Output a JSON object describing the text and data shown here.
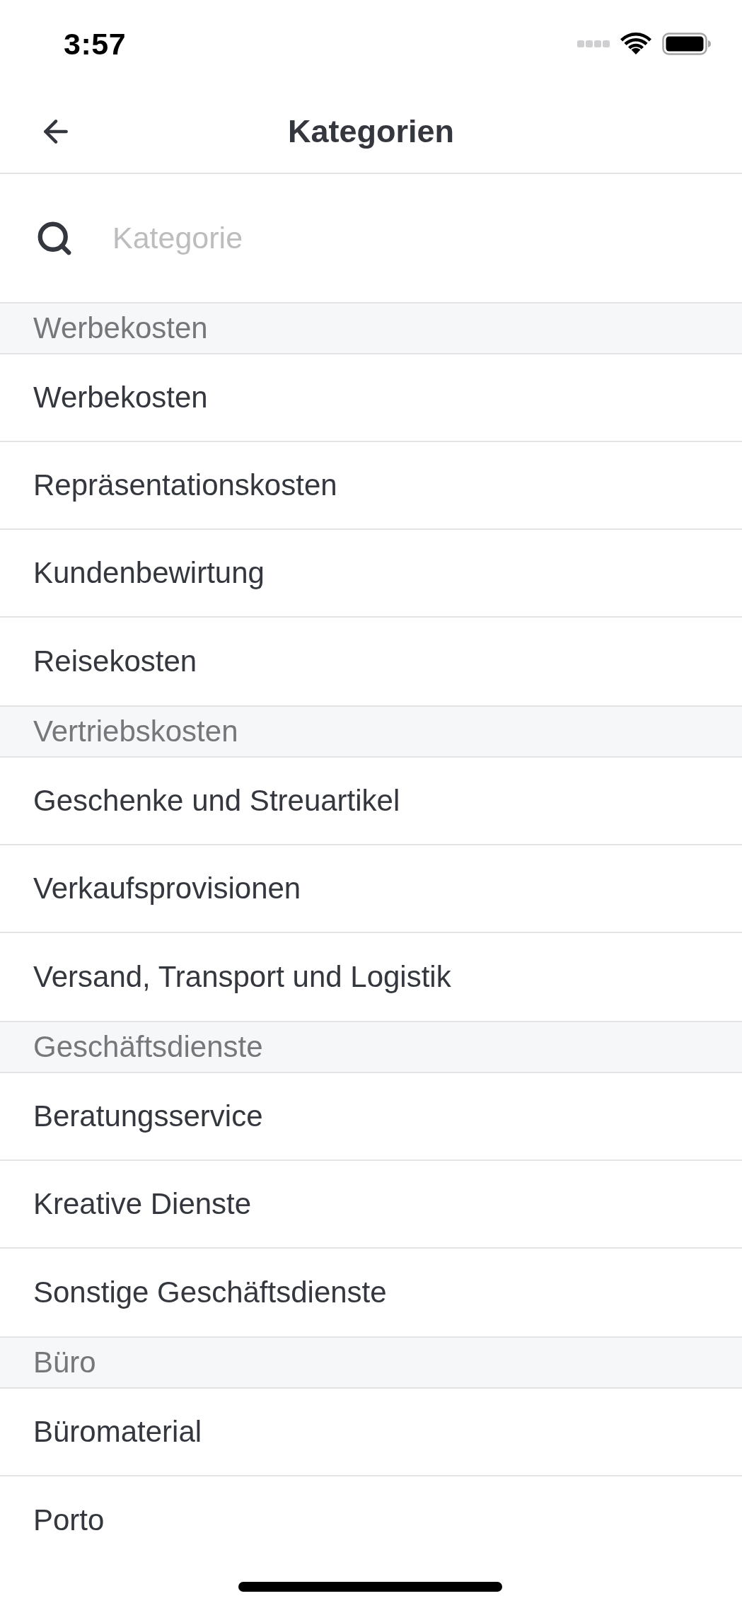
{
  "status_bar": {
    "time": "3:57"
  },
  "header": {
    "title": "Kategorien"
  },
  "search": {
    "placeholder": "Kategorie"
  },
  "sections": [
    {
      "title": "Werbekosten",
      "items": [
        "Werbekosten",
        "Repräsentationskosten",
        "Kundenbewirtung",
        "Reisekosten"
      ]
    },
    {
      "title": "Vertriebskosten",
      "items": [
        "Geschenke und Streuartikel",
        "Verkaufsprovisionen",
        "Versand, Transport und Logistik"
      ]
    },
    {
      "title": "Geschäftsdienste",
      "items": [
        "Beratungsservice",
        "Kreative Dienste",
        "Sonstige Geschäftsdienste"
      ]
    },
    {
      "title": "Büro",
      "items": [
        "Büromaterial",
        "Porto"
      ]
    }
  ]
}
